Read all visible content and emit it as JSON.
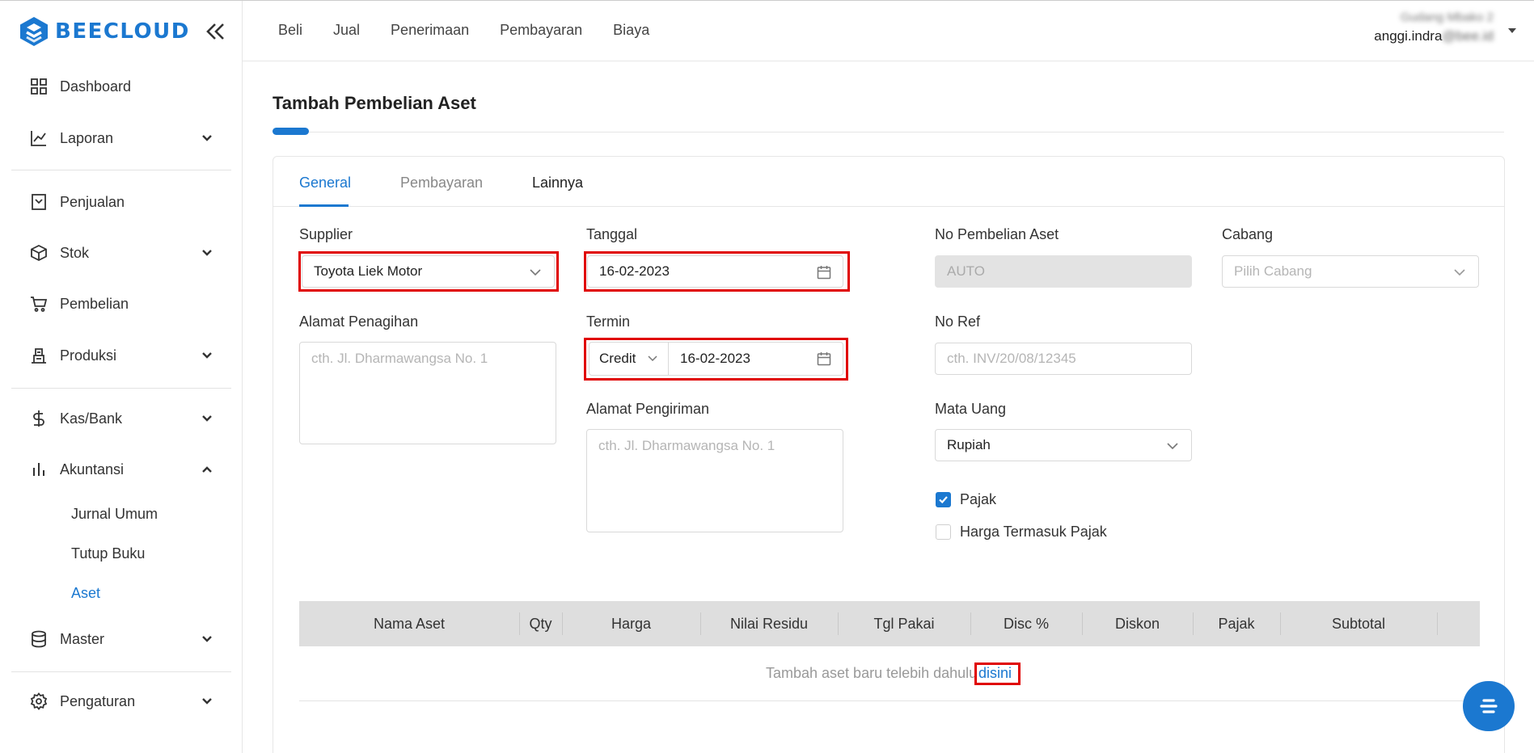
{
  "brand": {
    "name": "BEECLOUD",
    "color": "#1b78d0"
  },
  "sidebar": {
    "items": [
      {
        "label": "Dashboard",
        "icon": "grid-icon"
      },
      {
        "label": "Laporan",
        "icon": "chart-line-icon"
      },
      {
        "label": "Penjualan",
        "icon": "receipt-icon"
      },
      {
        "label": "Stok",
        "icon": "box-icon"
      },
      {
        "label": "Pembelian",
        "icon": "cart-icon"
      },
      {
        "label": "Produksi",
        "icon": "factory-icon"
      },
      {
        "label": "Kas/Bank",
        "icon": "dollar-icon"
      },
      {
        "label": "Akuntansi",
        "icon": "bar-chart-icon"
      },
      {
        "label": "Master",
        "icon": "database-icon"
      },
      {
        "label": "Pengaturan",
        "icon": "gear-icon"
      }
    ],
    "akuntansi_sub": [
      "Jurnal Umum",
      "Tutup Buku",
      "Aset"
    ]
  },
  "topnav": [
    "Beli",
    "Jual",
    "Penerimaan",
    "Pembayaran",
    "Biaya"
  ],
  "user": {
    "company": "Gudang Mbako 2",
    "email_visible": "anggi.indra",
    "email_hidden": "@bee.id"
  },
  "page": {
    "title": "Tambah Pembelian Aset"
  },
  "tabs": [
    "General",
    "Pembayaran",
    "Lainnya"
  ],
  "form": {
    "supplier_label": "Supplier",
    "supplier_value": "Toyota Liek Motor",
    "tanggal_label": "Tanggal",
    "tanggal_value": "16-02-2023",
    "no_pembelian_label": "No Pembelian Aset",
    "no_pembelian_value": "AUTO",
    "cabang_label": "Cabang",
    "cabang_placeholder": "Pilih Cabang",
    "alamat_penagihan_label": "Alamat Penagihan",
    "alamat_penagihan_placeholder": "cth. Jl. Dharmawangsa No. 1",
    "termin_label": "Termin",
    "termin_type": "Credit",
    "termin_date": "16-02-2023",
    "no_ref_label": "No Ref",
    "no_ref_placeholder": "cth. INV/20/08/12345",
    "alamat_pengiriman_label": "Alamat Pengiriman",
    "alamat_pengiriman_placeholder": "cth. Jl. Dharmawangsa No. 1",
    "mata_uang_label": "Mata Uang",
    "mata_uang_value": "Rupiah",
    "pajak_label": "Pajak",
    "pajak_checked": true,
    "harga_termasuk_pajak_label": "Harga Termasuk Pajak",
    "harga_termasuk_pajak_checked": false
  },
  "table": {
    "columns": [
      "Nama Aset",
      "Qty",
      "Harga",
      "Nilai Residu",
      "Tgl Pakai",
      "Disc %",
      "Diskon",
      "Pajak",
      "Subtotal"
    ],
    "empty_message": "Tambah aset baru telebih dahulu",
    "empty_link": "disini"
  }
}
